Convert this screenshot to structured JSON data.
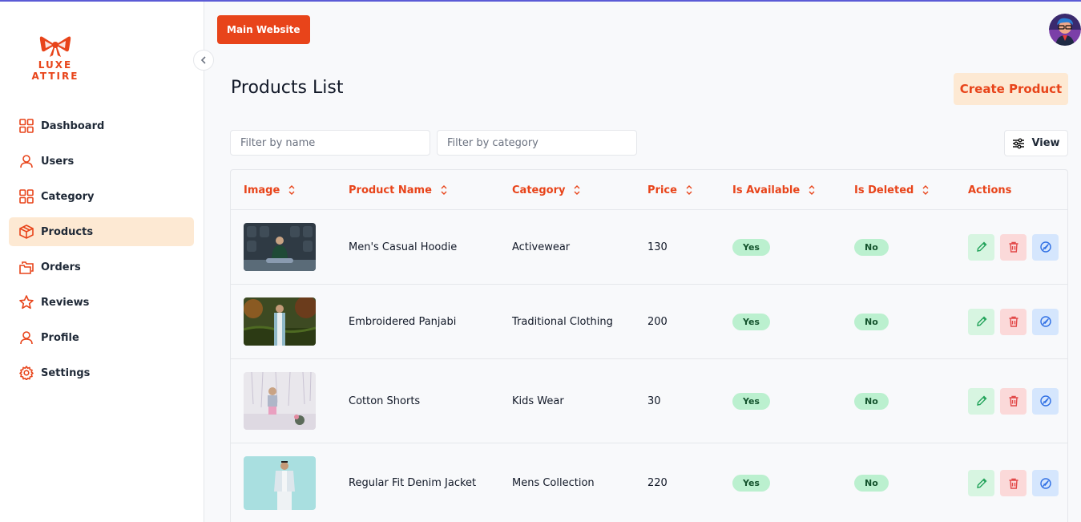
{
  "brand": {
    "name": "LUXE ATTIRE",
    "accent": "#e8441a"
  },
  "sidebar": {
    "items": [
      {
        "label": "Dashboard",
        "icon": "dashboard-icon",
        "active": false
      },
      {
        "label": "Users",
        "icon": "user-icon",
        "active": false
      },
      {
        "label": "Category",
        "icon": "category-icon",
        "active": false
      },
      {
        "label": "Products",
        "icon": "box-icon",
        "active": true
      },
      {
        "label": "Orders",
        "icon": "folders-icon",
        "active": false
      },
      {
        "label": "Reviews",
        "icon": "star-icon",
        "active": false
      },
      {
        "label": "Profile",
        "icon": "user-icon",
        "active": false
      },
      {
        "label": "Settings",
        "icon": "gear-icon",
        "active": false
      }
    ]
  },
  "header": {
    "main_website_label": "Main Website"
  },
  "page": {
    "title": "Products List",
    "create_label": "Create Product",
    "filter_name_placeholder": "Filter by name",
    "filter_category_placeholder": "Filter by category",
    "view_label": "View"
  },
  "table": {
    "columns": [
      "Image",
      "Product Name",
      "Category",
      "Price",
      "Is Available",
      "Is Deleted",
      "Actions"
    ],
    "rows": [
      {
        "name": "Men's Casual Hoodie",
        "category": "Activewear",
        "price": "130",
        "available": "Yes",
        "deleted": "No"
      },
      {
        "name": "Embroidered Panjabi",
        "category": "Traditional Clothing",
        "price": "200",
        "available": "Yes",
        "deleted": "No"
      },
      {
        "name": "Cotton Shorts",
        "category": "Kids Wear",
        "price": "30",
        "available": "Yes",
        "deleted": "No"
      },
      {
        "name": "Regular Fit Denim Jacket",
        "category": "Mens Collection",
        "price": "220",
        "available": "Yes",
        "deleted": "No"
      }
    ]
  }
}
